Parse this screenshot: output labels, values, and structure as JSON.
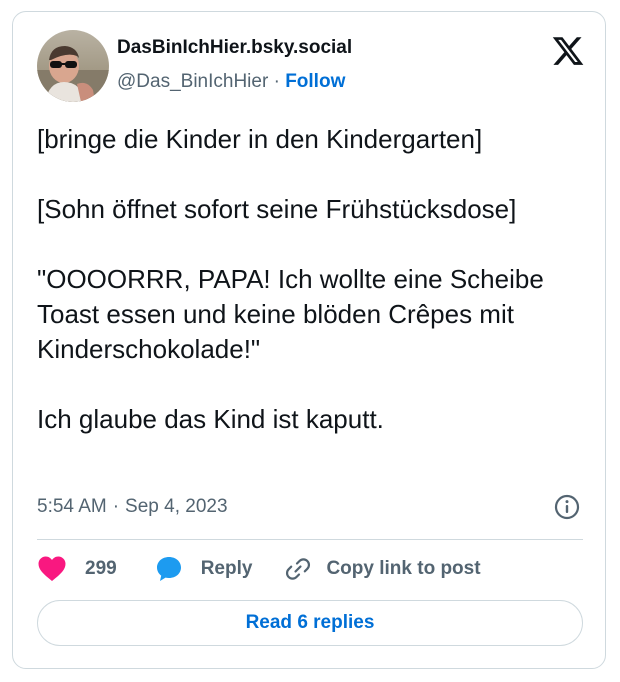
{
  "author": {
    "display_name": "DasBinIchHier.bsky.social",
    "handle": "@Das_BinIchHier",
    "separator": "·",
    "follow_label": "Follow",
    "avatar_icon": "avatar-photo",
    "platform_icon": "x-logo-icon"
  },
  "tweet": {
    "paragraphs": [
      "[bringe die Kinder in den Kindergarten]",
      "[Sohn öffnet sofort seine Frühstücksdose]",
      "\"OOOORRR, PAPA! Ich wollte eine Scheibe Toast essen und keine blöden Crêpes mit Kinderschokolade!\"",
      "Ich glaube das Kind ist kaputt."
    ],
    "time": "5:54 AM",
    "separator": "·",
    "date": "Sep 4, 2023",
    "info_icon": "info-icon"
  },
  "actions": {
    "like_icon": "heart-icon",
    "like_count": "299",
    "reply_icon": "speech-bubble-icon",
    "reply_label": "Reply",
    "copy_icon": "link-icon",
    "copy_label": "Copy link to post"
  },
  "footer": {
    "read_replies_label": "Read 6 replies"
  },
  "colors": {
    "text": "#0f1419",
    "muted": "#536471",
    "link": "#006fd6",
    "heart": "#f91880",
    "reply_bubble": "#1d9bf0",
    "border": "#cfd9de"
  }
}
